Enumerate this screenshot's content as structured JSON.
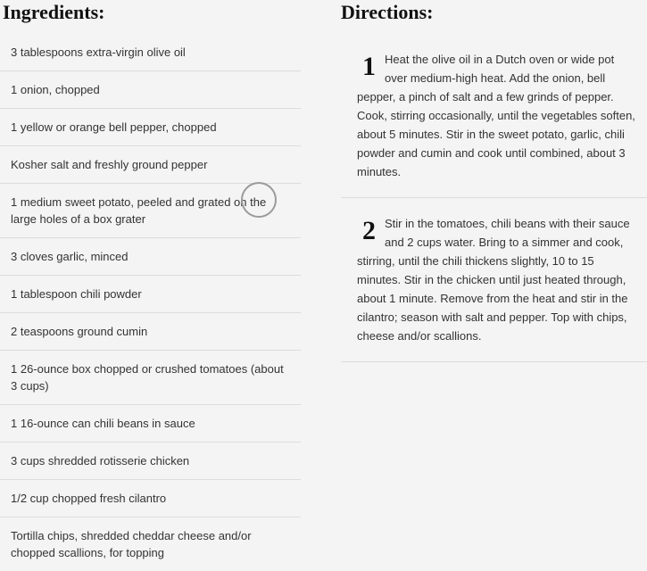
{
  "ingredients": {
    "heading": "Ingredients:",
    "items": [
      "3 tablespoons extra-virgin olive oil",
      "1 onion, chopped",
      "1 yellow or orange bell pepper, chopped",
      "Kosher salt and freshly ground pepper",
      "1 medium sweet potato, peeled and grated on the large holes of a box grater",
      "3 cloves garlic, minced",
      "1 tablespoon chili powder",
      "2 teaspoons ground cumin",
      "1 26-ounce box chopped or crushed tomatoes (about 3 cups)",
      "1 16-ounce can chili beans in sauce",
      "3 cups shredded rotisserie chicken",
      "1/2 cup chopped fresh cilantro",
      "Tortilla chips, shredded cheddar cheese and/or chopped scallions, for topping"
    ]
  },
  "directions": {
    "heading": "Directions:",
    "steps": [
      {
        "number": "1",
        "text": "Heat the olive oil in a Dutch oven or wide pot over medium-high heat. Add the onion, bell pepper, a pinch of salt and a few grinds of pepper. Cook, stirring occasionally, until the vegetables soften, about 5 minutes. Stir in the sweet potato, garlic, chili powder and cumin and cook until combined, about 3 minutes."
      },
      {
        "number": "2",
        "text": "Stir in the tomatoes, chili beans with their sauce and 2 cups water. Bring to a simmer and cook, stirring, until the chili thickens slightly, 10 to 15 minutes. Stir in the chicken until just heated through, about 1 minute. Remove from the heat and stir in the cilantro; season with salt and pepper. Top with chips, cheese and/or scallions."
      }
    ]
  }
}
